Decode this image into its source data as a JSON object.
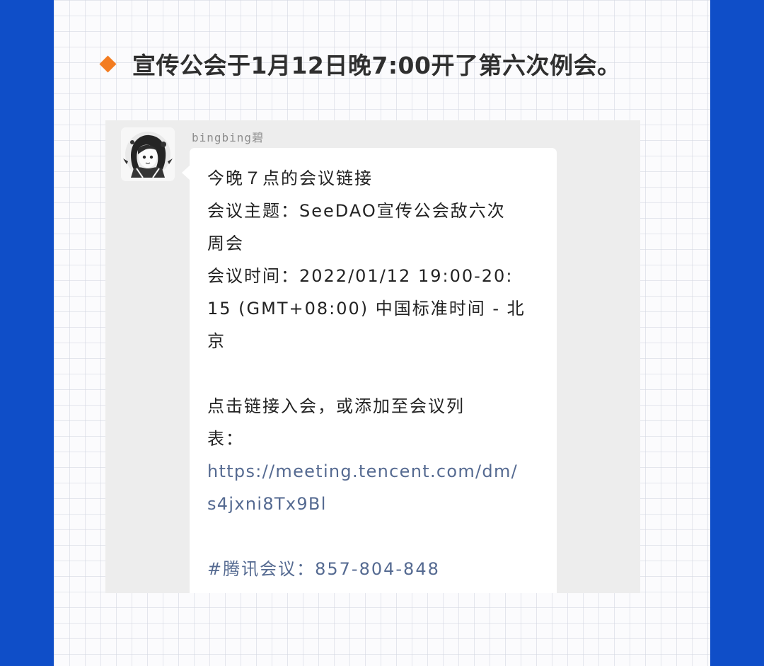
{
  "headline": {
    "text": "宣传公会于1月12日晚7:00开了第六次例会。"
  },
  "chat": {
    "sender_name": "bingbing碧",
    "message_lines": [
      {
        "text": "今晚７点的会议链接",
        "kind": "text"
      },
      {
        "text": "会议主题：SeeDAO宣传公会敌六次",
        "kind": "text"
      },
      {
        "text": "周会",
        "kind": "text"
      },
      {
        "text": "会议时间：2022/01/12 19:00-20:",
        "kind": "text"
      },
      {
        "text": "15 (GMT+08:00) 中国标准时间 - 北",
        "kind": "text"
      },
      {
        "text": "京",
        "kind": "text"
      },
      {
        "text": "",
        "kind": "blank"
      },
      {
        "text": "点击链接入会，或添加至会议列",
        "kind": "text"
      },
      {
        "text": "表：",
        "kind": "text"
      },
      {
        "text": "https://meeting.tencent.com/dm/",
        "kind": "link"
      },
      {
        "text": "s4jxni8Tx9Bl",
        "kind": "link"
      },
      {
        "text": "",
        "kind": "blank"
      },
      {
        "text": "#腾讯会议：857-804-848",
        "kind": "tag"
      }
    ]
  },
  "colors": {
    "side_bars": "#0f4ec8",
    "accent_diamond": "#f37c21",
    "link_text": "#556a91",
    "chat_background": "#ededed"
  },
  "icons": {
    "headline_marker": "diamond-bullet-icon",
    "avatar": "anime-girl-avatar-icon"
  }
}
